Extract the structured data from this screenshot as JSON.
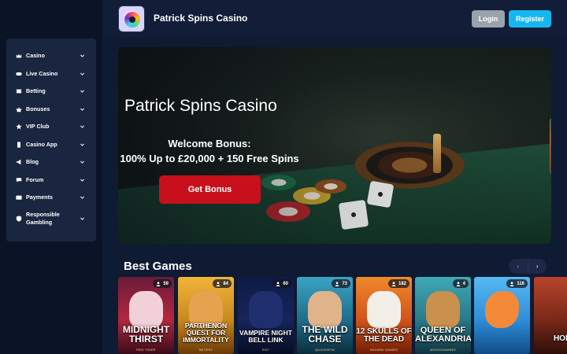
{
  "header": {
    "site_title": "Patrick Spins Casino",
    "login_label": "Login",
    "register_label": "Register",
    "register_color": "#16b7f0"
  },
  "sidebar": {
    "items": [
      {
        "label": "Casino",
        "icon": "crown-icon"
      },
      {
        "label": "Live Casino",
        "icon": "toggle-icon"
      },
      {
        "label": "Betting",
        "icon": "ticket-icon"
      },
      {
        "label": "Bonuses",
        "icon": "gift-icon"
      },
      {
        "label": "VIP Club",
        "icon": "star-icon"
      },
      {
        "label": "Casino App",
        "icon": "phone-icon"
      },
      {
        "label": "Blog",
        "icon": "megaphone-icon"
      },
      {
        "label": "Forum",
        "icon": "chat-icon"
      },
      {
        "label": "Payments",
        "icon": "wallet-icon"
      },
      {
        "label": "Responsible Gambling",
        "icon": "shield-icon"
      }
    ]
  },
  "hero": {
    "title": "Patrick Spins Casino",
    "bonus_line1": "Welcome Bonus:",
    "bonus_line2": "100% Up to £20,000 + 150 Free Spins",
    "cta_label": "Get Bonus",
    "cta_color": "#c8101c"
  },
  "best_games": {
    "title": "Best Games",
    "prev_label": "‹",
    "next_label": "›",
    "games": [
      {
        "name": "MIDNIGHT THIRST",
        "provider": "RED TIGER",
        "players": "59",
        "bg": "#b3273e"
      },
      {
        "name": "PARTHENON QUEST FOR IMMORTALITY",
        "provider": "NETENT",
        "players": "84",
        "bg": "#c98a1f"
      },
      {
        "name": "VAMPIRE NIGHT BELL LINK",
        "provider": "EGT",
        "players": "60",
        "bg": "#16255a"
      },
      {
        "name": "THE WILD CHASE",
        "provider": "QUICKSPIN",
        "players": "73",
        "bg": "#1f6e8c"
      },
      {
        "name": "12 SKULLS OF THE DEAD",
        "provider": "WIZARD GAMES",
        "players": "182",
        "bg": "#d2541b"
      },
      {
        "name": "QUEEN OF ALEXANDRIA",
        "provider": "MICROGAMING",
        "players": "4",
        "bg": "#2a7a8a"
      },
      {
        "name": "",
        "provider": "",
        "players": "116",
        "bg": "#2f8fd9"
      },
      {
        "name": "HOL",
        "provider": "",
        "players": "",
        "bg": "#7a2a1a"
      }
    ]
  }
}
